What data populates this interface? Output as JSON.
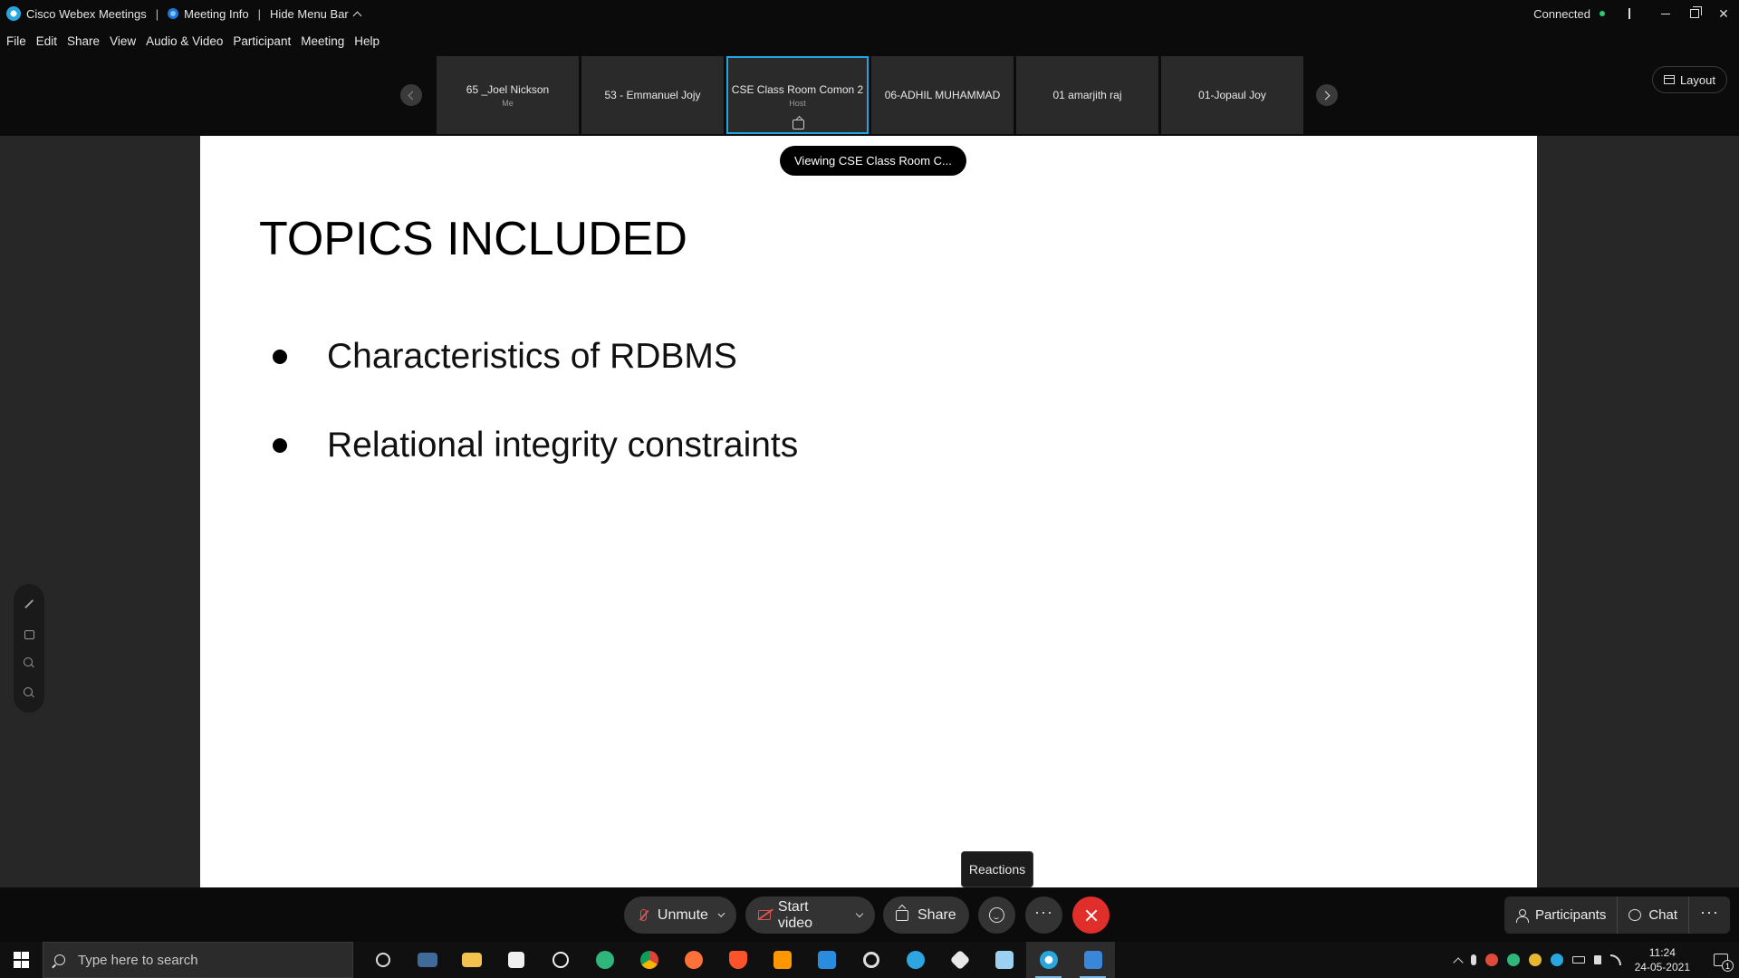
{
  "titlebar": {
    "app_title": "Cisco Webex Meetings",
    "meeting_info": "Meeting Info",
    "hide_menu": "Hide Menu Bar",
    "status": "Connected",
    "status_color": "#2ecc71"
  },
  "menu": {
    "items": [
      "File",
      "Edit",
      "Share",
      "View",
      "Audio & Video",
      "Participant",
      "Meeting",
      "Help"
    ]
  },
  "filmstrip": {
    "tiles": [
      {
        "name": "65 _Joel Nickson",
        "sub": "Me"
      },
      {
        "name": "53 - Emmanuel Jojy",
        "sub": ""
      },
      {
        "name": "CSE Class Room Comon 2",
        "sub": "Host"
      },
      {
        "name": "06-ADHIL MUHAMMAD",
        "sub": ""
      },
      {
        "name": "01 amarjith raj",
        "sub": ""
      },
      {
        "name": "01-Jopaul Joy",
        "sub": ""
      }
    ],
    "active_tile": "CSE Class Room Comon 2",
    "active_color": "#1ea7e1",
    "layout_label": "Layout"
  },
  "share": {
    "viewing_label": "Viewing CSE Class Room C..."
  },
  "slide": {
    "title": "TOPICS INCLUDED",
    "bullets": [
      "Characteristics of RDBMS",
      "Relational integrity constraints"
    ]
  },
  "annotation_tools": [
    "pen-icon",
    "eraser-icon",
    "zoom-in-icon",
    "zoom-out-icon"
  ],
  "tooltip": {
    "reactions": "Reactions"
  },
  "controls": {
    "unmute": "Unmute",
    "start_video": "Start video",
    "share": "Share",
    "participants": "Participants",
    "chat": "Chat",
    "more": "···",
    "end_color": "#e02e2a",
    "muted_color": "#d9534f"
  },
  "taskbar": {
    "search_placeholder": "Type here to search",
    "time": "11:24",
    "date": "24-05-2021",
    "notifications": "1",
    "apps": [
      "task-view",
      "file-manager",
      "folder",
      "store",
      "xbox",
      "edge",
      "chrome",
      "firefox",
      "brave",
      "sublime",
      "vscode",
      "media",
      "telegram",
      "app",
      "notepad",
      "webex",
      "app-window"
    ]
  }
}
